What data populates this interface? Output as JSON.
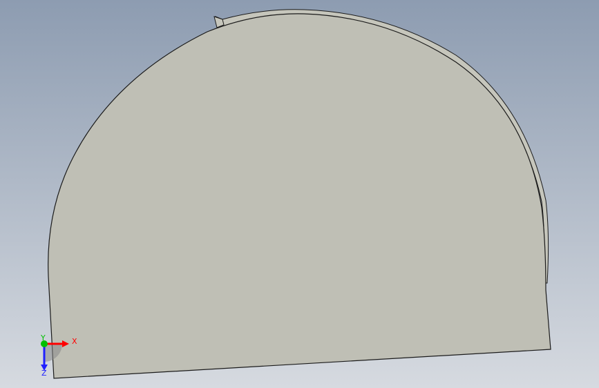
{
  "viewport": {
    "background_top": "#8d9cb1",
    "background_bottom": "#d6dae0",
    "part_fill": "#bfbfb5",
    "part_outline": "#1a1a1a"
  },
  "triad": {
    "x_label": "X",
    "y_label": "Y",
    "z_label": "Z",
    "x_color": "#ff0000",
    "y_color": "#00c000",
    "z_color": "#2020ff"
  }
}
